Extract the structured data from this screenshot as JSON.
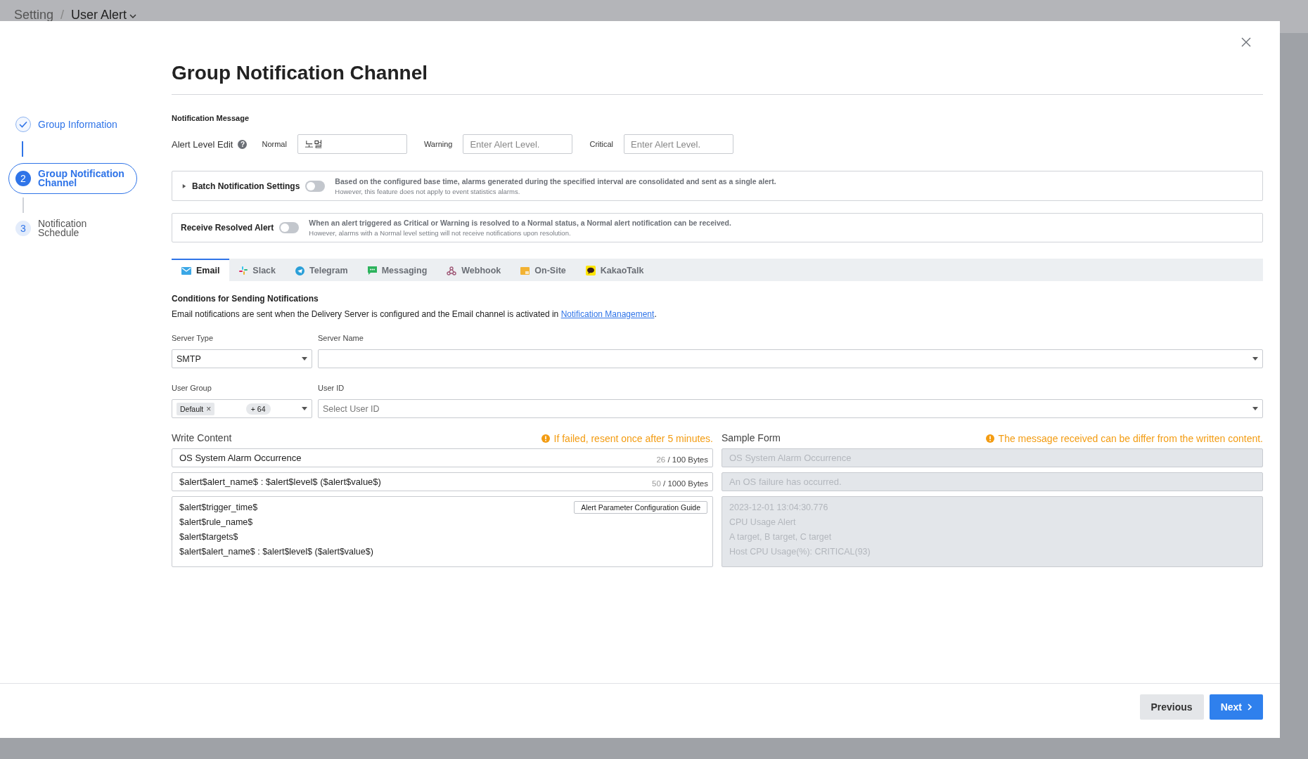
{
  "breadcrumb": {
    "items": [
      "Setting",
      "User Alert"
    ],
    "separator": "/"
  },
  "steps": [
    {
      "label": "Group Information",
      "completed": true,
      "selected": false
    },
    {
      "number": "2",
      "label": "Group Notification Channel",
      "completed": false,
      "selected": true
    },
    {
      "number": "3",
      "label": "Notification Schedule",
      "completed": false,
      "selected": false
    }
  ],
  "title": "Group Notification Channel",
  "notification_message": {
    "heading": "Notification Message",
    "alert_level_label": "Alert Level Edit",
    "help": "?",
    "levels": [
      {
        "label": "Normal",
        "value": "노멀"
      },
      {
        "label": "Warning",
        "placeholder": "Enter Alert Level."
      },
      {
        "label": "Critical",
        "placeholder": "Enter Alert Level."
      }
    ]
  },
  "batch": {
    "label": "Batch Notification Settings",
    "expanded": false,
    "on": false,
    "description": "Based on the configured base time, alarms generated during the specified interval are consolidated and sent as a single alert.",
    "note": "However, this feature does not apply to event statistics alarms."
  },
  "resolved": {
    "label": "Receive Resolved Alert",
    "on": false,
    "description": "When an alert triggered as Critical or Warning is resolved to a Normal status, a Normal alert notification can be received.",
    "note": "However, alarms with a Normal level setting will not receive notifications upon resolution."
  },
  "tabs": [
    {
      "label": "Email",
      "selected": true
    },
    {
      "label": "Slack",
      "selected": false
    },
    {
      "label": "Telegram",
      "selected": false
    },
    {
      "label": "Messaging",
      "selected": false
    },
    {
      "label": "Webhook",
      "selected": false
    },
    {
      "label": "On-Site",
      "selected": false
    },
    {
      "label": "KakaoTalk",
      "selected": false
    }
  ],
  "conditions": {
    "heading": "Conditions for Sending Notifications",
    "text_before": "Email notifications are sent when the Delivery Server is configured and the Email channel is activated in ",
    "link": "Notification Management",
    "text_after": "."
  },
  "server_type": {
    "label": "Server Type",
    "value": "SMTP"
  },
  "server_name": {
    "label": "Server Name"
  },
  "user_group": {
    "label": "User Group",
    "tags": [
      "Default"
    ],
    "remove": "×",
    "more": "+ 64"
  },
  "user_id": {
    "label": "User ID",
    "placeholder": "Select User ID"
  },
  "write_content": {
    "label": "Write Content",
    "warning": "If failed, resent once after 5 minutes.",
    "subject": {
      "value": "OS System Alarm Occurrence",
      "count": "26",
      "limit": "/ 100 Bytes"
    },
    "summary": {
      "value": "$alert$alert_name$ : $alert$level$ ($alert$value$)",
      "count": "50",
      "limit": "/ 1000 Bytes"
    },
    "body": [
      "$alert$trigger_time$",
      "$alert$rule_name$",
      "$alert$targets$",
      "$alert$alert_name$ : $alert$level$ ($alert$value$)"
    ],
    "guide_button": "Alert Parameter Configuration Guide"
  },
  "sample_form": {
    "label": "Sample Form",
    "warning": "The message received can be differ from the written content.",
    "subject": "OS System Alarm Occurrence",
    "summary": "An OS failure has occurred.",
    "body": [
      "2023-12-01 13:04:30.776",
      "CPU Usage Alert",
      "A target, B target, C target",
      "Host CPU Usage(%): CRITICAL(93)"
    ]
  },
  "footer": {
    "previous": "Previous",
    "next": "Next"
  }
}
